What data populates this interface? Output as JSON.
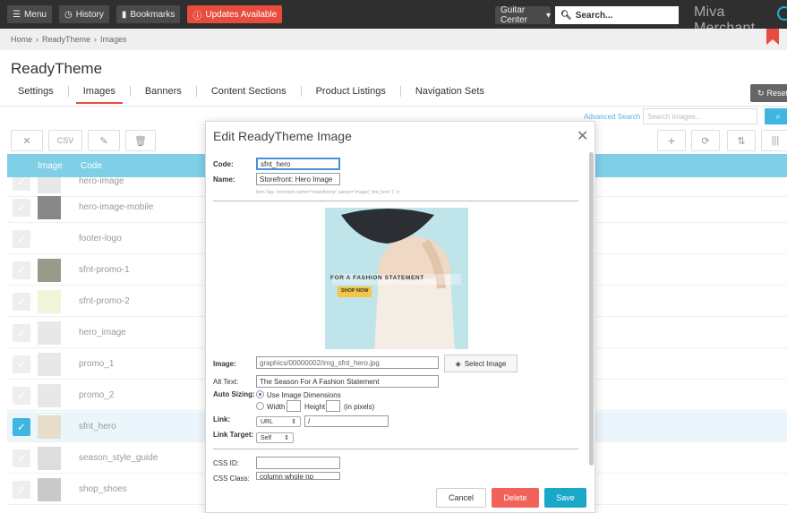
{
  "topbar": {
    "menu_label": "Menu",
    "history_label": "History",
    "bookmarks_label": "Bookmarks",
    "updates_label": "Updates Available",
    "store_selector": "Guitar Center",
    "search_placeholder": "Search...",
    "brand": "Miva Merchant"
  },
  "breadcrumb": [
    "Home",
    "ReadyTheme",
    "Images"
  ],
  "page": {
    "title": "ReadyTheme",
    "reset_label": "Reset"
  },
  "tabs": [
    {
      "label": "Settings"
    },
    {
      "label": "Images"
    },
    {
      "label": "Banners"
    },
    {
      "label": "Content Sections"
    },
    {
      "label": "Product Listings"
    },
    {
      "label": "Navigation Sets"
    }
  ],
  "search": {
    "advanced_label": "Advanced Search",
    "placeholder": "Search Images..."
  },
  "toolbar": {
    "csv_label": "CSV"
  },
  "table": {
    "headers": {
      "image": "Image",
      "code": "Code"
    },
    "rows": [
      {
        "code": "hero-image",
        "selected": false
      },
      {
        "code": "hero-image-mobile",
        "selected": false
      },
      {
        "code": "footer-logo",
        "selected": false
      },
      {
        "code": "sfnt-promo-1",
        "selected": false
      },
      {
        "code": "sfnt-promo-2",
        "selected": false
      },
      {
        "code": "hero_image",
        "selected": false
      },
      {
        "code": "promo_1",
        "selected": false
      },
      {
        "code": "promo_2",
        "selected": false
      },
      {
        "code": "sfnt_hero",
        "selected": true
      },
      {
        "code": "season_style_guide",
        "selected": false
      },
      {
        "code": "shop_shoes",
        "selected": false
      }
    ]
  },
  "modal": {
    "title": "Edit ReadyTheme Image",
    "code_label": "Code:",
    "code_value": "sfnt_hero",
    "name_label": "Name:",
    "name_value": "Storefront: Hero Image",
    "item_tag": "Item Tag: <mvt:item name=\"readytheme\" param=\"image( 'sfnt_hero' )\" />",
    "hero_text": "FOR A FASHION STATEMENT",
    "hero_cta": "SHOP NOW",
    "image_label": "Image:",
    "image_value": "graphics/00000002/img_sfnt_hero.jpg",
    "select_image_label": "Select Image",
    "alt_label": "Alt Text:",
    "alt_value": "The Season For A Fashion Statement",
    "auto_sizing_label": "Auto Sizing:",
    "use_dimensions_label": "Use Image Dimensions",
    "width_label": "Width",
    "height_label": "Height",
    "pixels_label": "(in pixels)",
    "link_label": "Link:",
    "link_type": "URL",
    "link_value": "/",
    "link_target_label": "Link Target:",
    "link_target_value": "Self",
    "css_id_label": "CSS ID:",
    "css_id_value": "",
    "css_class_label": "CSS Class:",
    "css_class_value": "column whole np",
    "cancel_label": "Cancel",
    "delete_label": "Delete",
    "save_label": "Save"
  },
  "colors": {
    "accent": "#3fb5e0",
    "danger": "#f0625a",
    "save": "#1aa8c9",
    "table_header": "#7fd0e6"
  }
}
